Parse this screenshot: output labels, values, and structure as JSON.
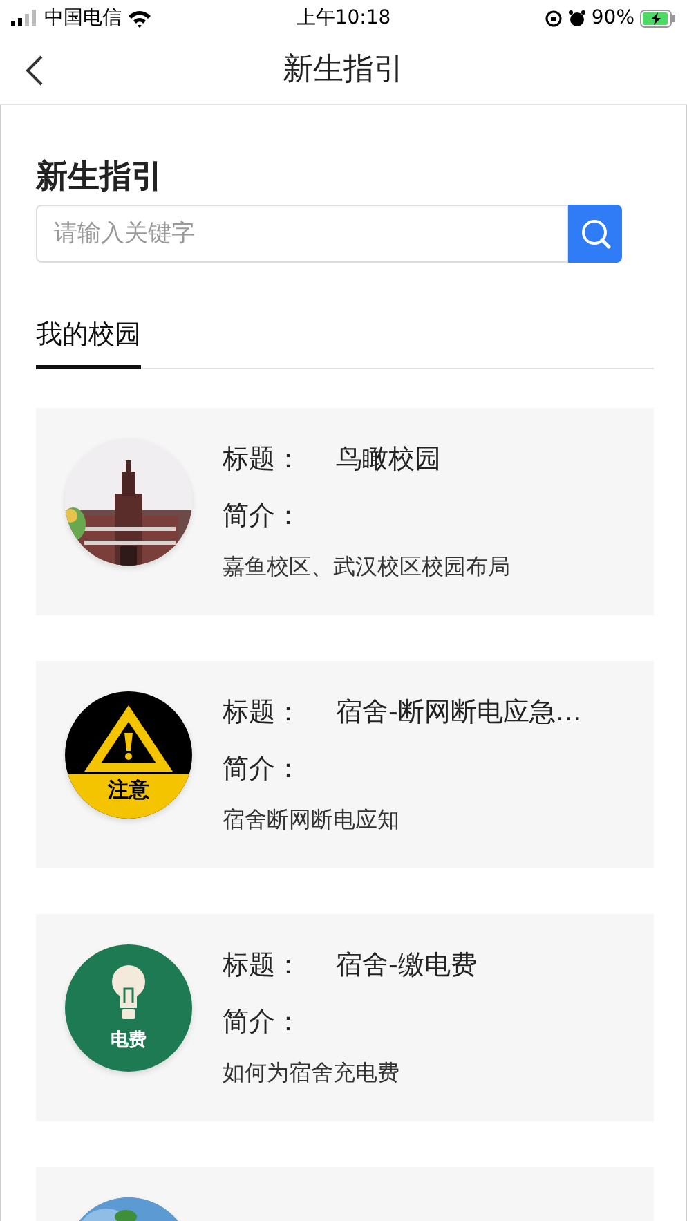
{
  "status_bar": {
    "carrier": "中国电信",
    "time": "上午10:18",
    "battery": "90%"
  },
  "nav": {
    "title": "新生指引"
  },
  "heading": "新生指引",
  "search": {
    "placeholder": "请输入关键字"
  },
  "tabs": [
    {
      "label": "我的校园",
      "selected": true
    }
  ],
  "cards": [
    {
      "title_label": "标题：",
      "title": "鸟瞰校园",
      "intro_label": "简介：",
      "description": "嘉鱼校区、武汉校区校园布局"
    },
    {
      "kind": "warning",
      "badge_text": "注意",
      "title_label": "标题：",
      "title": "宿舍-断网断电应急…",
      "intro_label": "简介：",
      "description": "宿舍断网断电应知"
    },
    {
      "kind": "bulb",
      "badge_text": "电费",
      "title_label": "标题：",
      "title": "宿舍-缴电费",
      "intro_label": "简介：",
      "description": "如何为宿舍充电费"
    },
    {
      "kind": "globe"
    }
  ]
}
